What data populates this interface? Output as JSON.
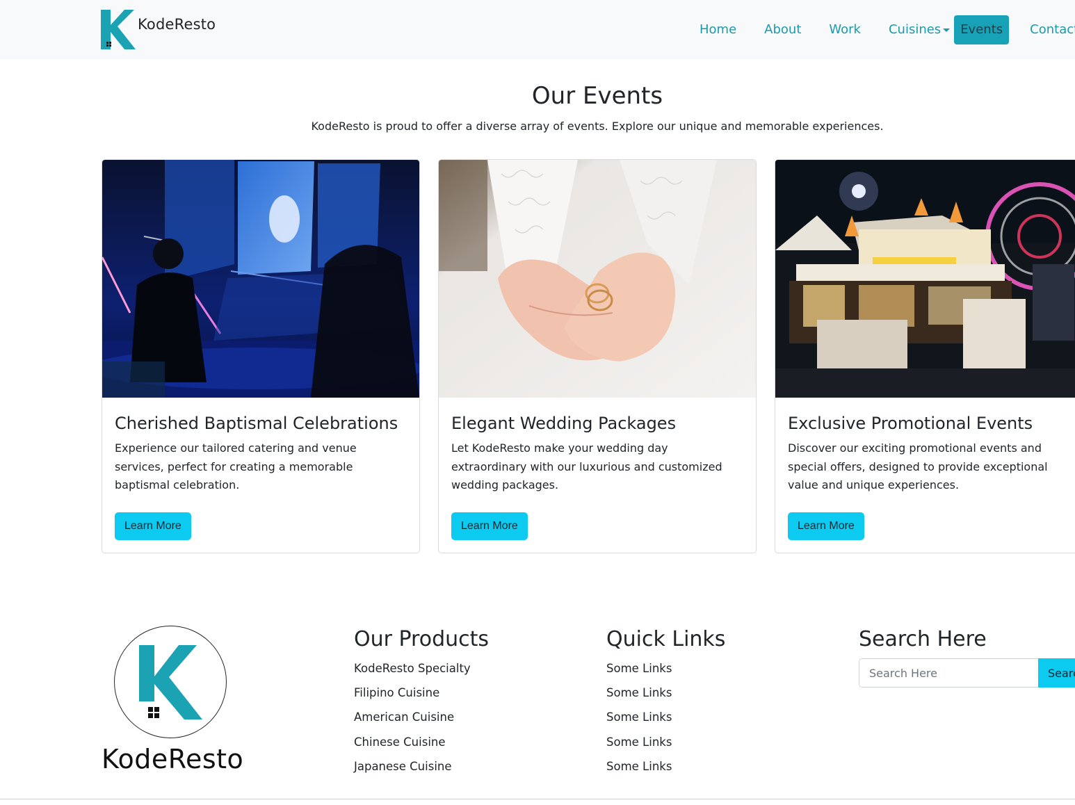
{
  "navbar": {
    "brand": "KodeResto",
    "links": [
      {
        "label": "Home"
      },
      {
        "label": "About"
      },
      {
        "label": "Work"
      },
      {
        "label": "Cuisines"
      },
      {
        "label": "Events"
      },
      {
        "label": "Contact Us"
      }
    ],
    "active": "Events"
  },
  "section": {
    "title": "Our Events",
    "subtitle": "KodeResto is proud to offer a diverse array of events. Explore our unique and memorable experiences."
  },
  "cards": [
    {
      "title": "Cherished Baptismal Celebrations",
      "text": "Experience our tailored catering and venue services, perfect for creating a memorable baptismal celebration.",
      "button": "Learn More",
      "image": "concert-stage-photo"
    },
    {
      "title": "Elegant Wedding Packages",
      "text": "Let KodeResto make your wedding day extraordinary with our luxurious and customized wedding packages.",
      "button": "Learn More",
      "image": "wedding-rings-photo"
    },
    {
      "title": "Exclusive Promotional Events",
      "text": "Discover our exciting promotional events and special offers, designed to provide exceptional value and unique experiences.",
      "button": "Learn More",
      "image": "carnival-booths-photo"
    }
  ],
  "footer": {
    "brand": "KodeResto",
    "products": {
      "heading": "Our Products",
      "items": [
        "KodeResto Specialty",
        "Filipino Cuisine",
        "American Cuisine",
        "Chinese Cuisine",
        "Japanese Cuisine"
      ]
    },
    "quick_links": {
      "heading": "Quick Links",
      "items": [
        "Some Links",
        "Some Links",
        "Some Links",
        "Some Links",
        "Some Links"
      ]
    },
    "search": {
      "heading": "Search Here",
      "placeholder": "Search Here",
      "button": "Search"
    }
  },
  "colors": {
    "accent": "#17a2b8",
    "button": "#0dcaf0",
    "nav_link": "#1a9aaa",
    "logo_teal": "#1ba3b4"
  }
}
